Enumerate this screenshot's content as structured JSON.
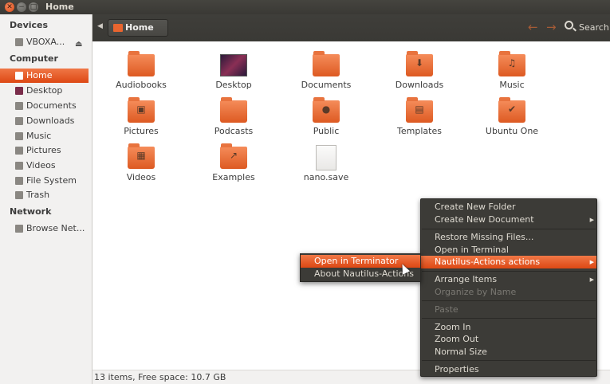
{
  "window": {
    "title": "Home"
  },
  "sidebar": {
    "devices_header": "Devices",
    "device": {
      "label": "VBOXA...",
      "icon": "drive-icon"
    },
    "computer_header": "Computer",
    "computer_items": [
      {
        "label": "Home",
        "icon": "home-folder-icon",
        "color": "#e9652f"
      },
      {
        "label": "Desktop",
        "icon": "desktop-icon",
        "color": "#7a2c4a"
      },
      {
        "label": "Documents",
        "icon": "documents-icon",
        "color": "#8a8782"
      },
      {
        "label": "Downloads",
        "icon": "downloads-icon",
        "color": "#8a8782"
      },
      {
        "label": "Music",
        "icon": "music-icon",
        "color": "#8a8782"
      },
      {
        "label": "Pictures",
        "icon": "pictures-icon",
        "color": "#8a8782"
      },
      {
        "label": "Videos",
        "icon": "videos-icon",
        "color": "#8a8782"
      },
      {
        "label": "File System",
        "icon": "file-system-icon",
        "color": "#8a8782"
      },
      {
        "label": "Trash",
        "icon": "trash-icon",
        "color": "#8a8782"
      }
    ],
    "network_header": "Network",
    "network_items": [
      {
        "label": "Browse Net...",
        "icon": "network-icon"
      }
    ]
  },
  "toolbar": {
    "breadcrumb": "Home",
    "search_label": "Search"
  },
  "files": [
    {
      "name": "Audiobooks",
      "type": "folder",
      "emblem": ""
    },
    {
      "name": "Desktop",
      "type": "desktop",
      "emblem": ""
    },
    {
      "name": "Documents",
      "type": "folder",
      "emblem": ""
    },
    {
      "name": "Downloads",
      "type": "folder",
      "emblem": "⬇"
    },
    {
      "name": "Music",
      "type": "folder",
      "emblem": "♫"
    },
    {
      "name": "Pictures",
      "type": "folder",
      "emblem": "▣"
    },
    {
      "name": "Podcasts",
      "type": "folder",
      "emblem": ""
    },
    {
      "name": "Public",
      "type": "folder",
      "emblem": "●"
    },
    {
      "name": "Templates",
      "type": "folder",
      "emblem": "▤"
    },
    {
      "name": "Ubuntu One",
      "type": "folder",
      "emblem": "✔"
    },
    {
      "name": "Videos",
      "type": "folder",
      "emblem": "▦"
    },
    {
      "name": "Examples",
      "type": "folder",
      "emblem": "↗"
    },
    {
      "name": "nano.save",
      "type": "document",
      "emblem": ""
    }
  ],
  "statusbar": {
    "text": "13 items, Free space: 10.7 GB"
  },
  "context_menu": {
    "items": [
      {
        "label": "Create New Folder",
        "submenu": false,
        "disabled": false,
        "active": false
      },
      {
        "label": "Create New Document",
        "submenu": true,
        "disabled": false,
        "active": false
      },
      {
        "label": "Restore Missing Files...",
        "submenu": false,
        "disabled": false,
        "active": false
      },
      {
        "label": "Open in Terminal",
        "submenu": false,
        "disabled": false,
        "active": false
      },
      {
        "label": "Nautilus-Actions actions",
        "submenu": true,
        "disabled": false,
        "active": true
      },
      {
        "label": "Arrange Items",
        "submenu": true,
        "disabled": false,
        "active": false
      },
      {
        "label": "Organize by Name",
        "submenu": false,
        "disabled": true,
        "active": false
      },
      {
        "label": "Paste",
        "submenu": false,
        "disabled": true,
        "active": false
      },
      {
        "label": "Zoom In",
        "submenu": false,
        "disabled": false,
        "active": false
      },
      {
        "label": "Zoom Out",
        "submenu": false,
        "disabled": false,
        "active": false
      },
      {
        "label": "Normal Size",
        "submenu": false,
        "disabled": false,
        "active": false
      },
      {
        "label": "Properties",
        "submenu": false,
        "disabled": false,
        "active": false
      }
    ]
  },
  "submenu": {
    "items": [
      {
        "label": "Open in Terminator",
        "active": true
      },
      {
        "label": "About Nautilus-Actions",
        "active": false
      }
    ]
  }
}
